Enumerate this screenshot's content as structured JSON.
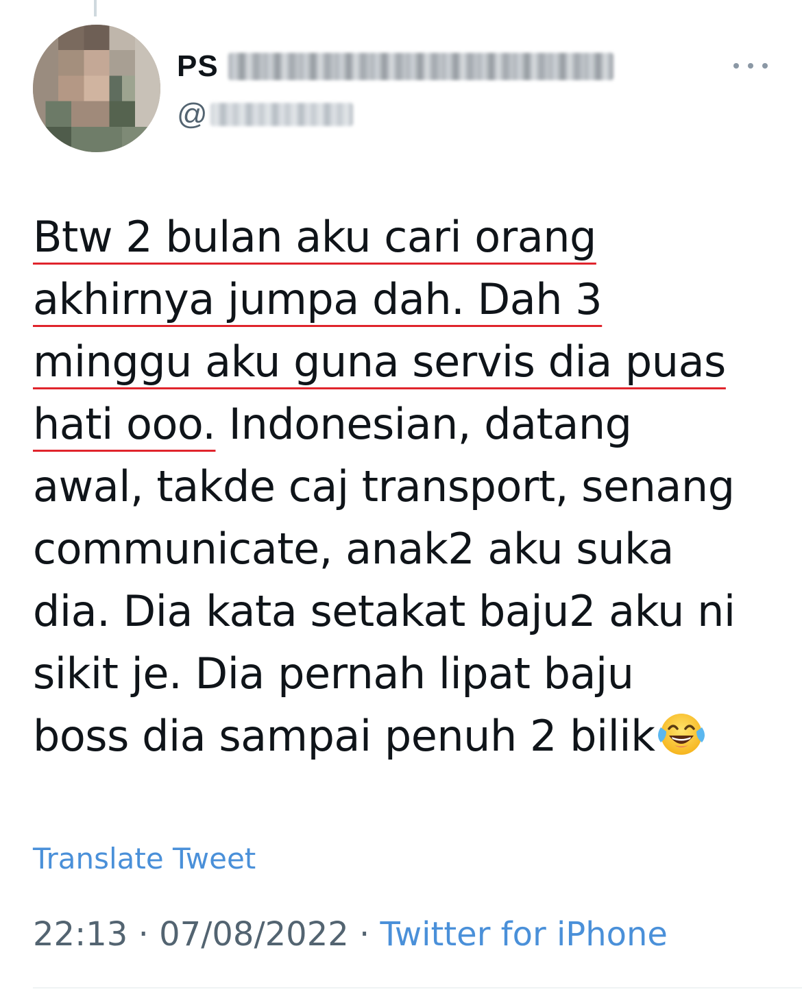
{
  "author": {
    "display_name_visible": "PS",
    "handle_prefix": "@",
    "name_obscured": true,
    "handle_obscured": true,
    "avatar_obscured": true
  },
  "menu": {
    "more_icon": "more-horizontal-icon"
  },
  "tweet": {
    "lines": [
      "Btw 2 bulan aku cari orang",
      "akhirnya jumpa dah. Dah 3",
      "minggu aku guna servis dia puas",
      "hati ooo.",
      " Indonesian, datang",
      "awal, takde caj transport, senang",
      "communicate, anak2 aku suka",
      "dia. Dia kata setakat baju2 aku ni",
      "sikit je. Dia pernah lipat baju",
      "boss dia sampai penuh 2 bilik"
    ],
    "emoji": "face-with-tears-of-joy-icon",
    "underline_color": "#e0242c"
  },
  "translate_label": "Translate Tweet",
  "meta": {
    "time": "22:13",
    "separator": " · ",
    "date": "07/08/2022",
    "source": "Twitter for iPhone"
  },
  "colors": {
    "link": "#4a90d9",
    "secondary_text": "#536471",
    "primary_text": "#0f1419"
  }
}
